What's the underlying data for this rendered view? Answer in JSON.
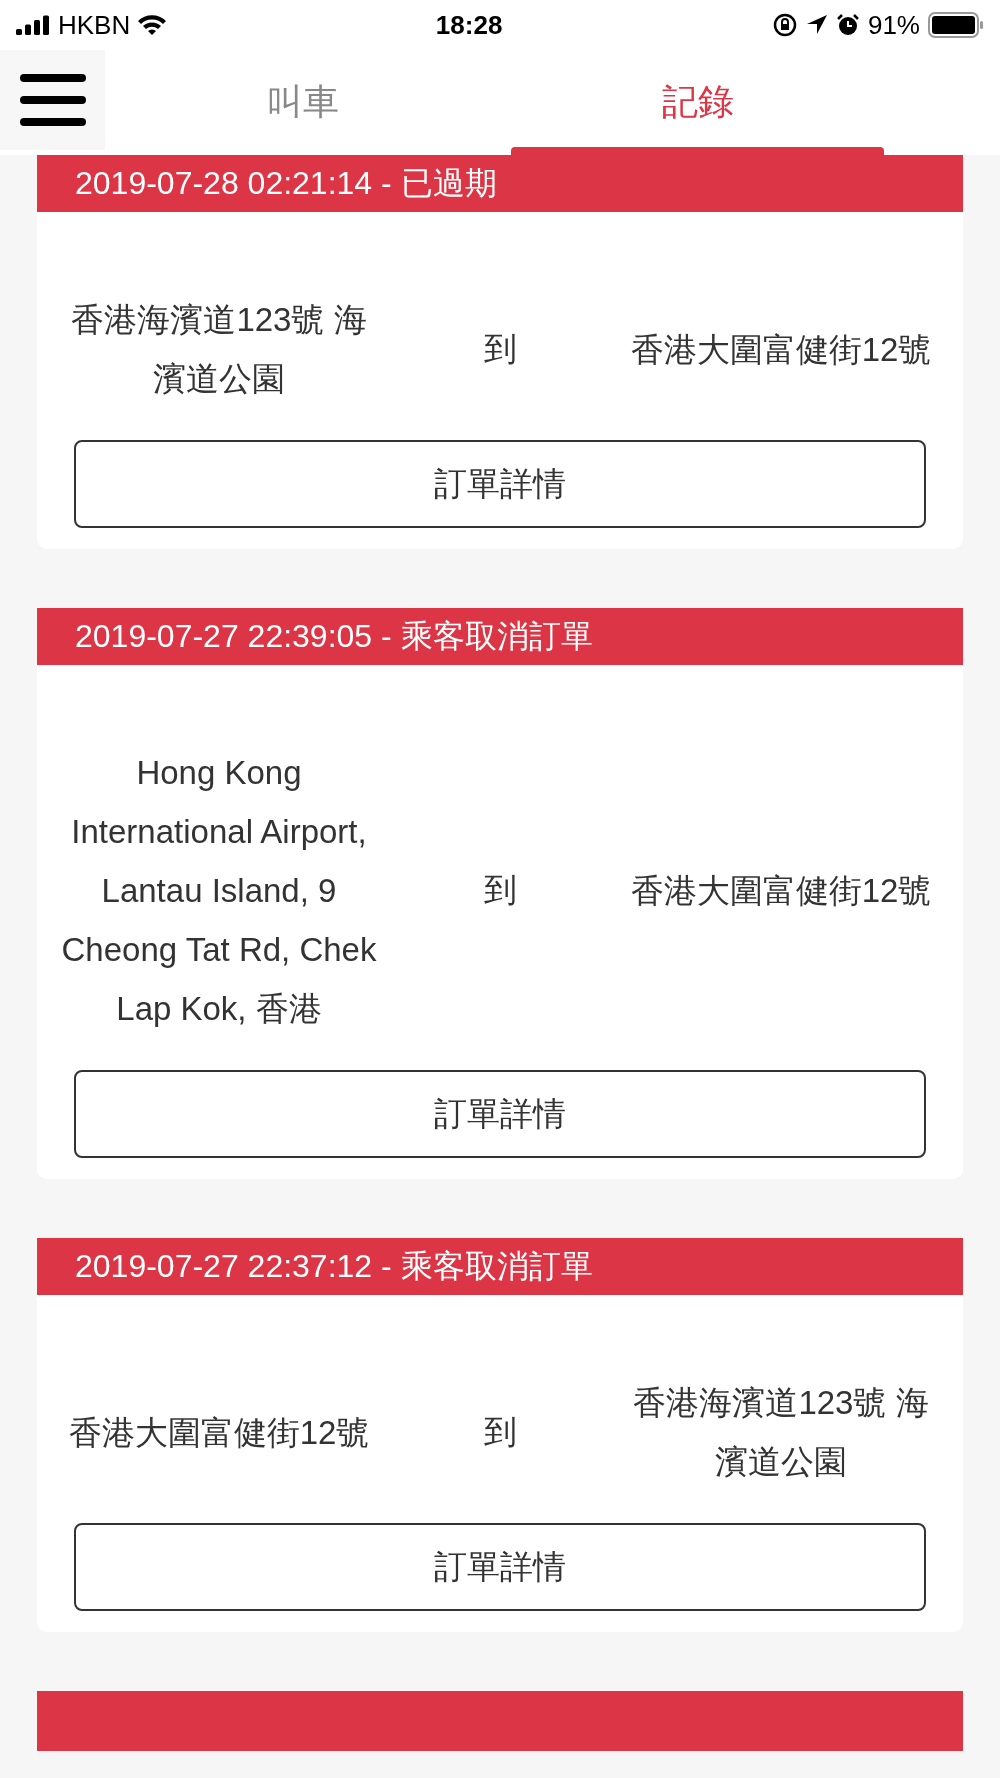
{
  "status_bar": {
    "carrier": "HKBN",
    "time": "18:28",
    "battery": "91%"
  },
  "tabs": [
    {
      "label": "叫車",
      "selected": false
    },
    {
      "label": "記錄",
      "selected": true
    }
  ],
  "orders": [
    {
      "kind": "full",
      "header": "2019-07-28 02:21:14 - 已過期",
      "from": "香港海濱道123號 海濱道公園",
      "connector": "到",
      "to": "香港大圍富健街12號",
      "button": "訂單詳情"
    },
    {
      "kind": "full",
      "header": "2019-07-27 22:39:05 - 乘客取消訂單",
      "from": "Hong Kong International Airport, Lantau Island, 9 Cheong Tat Rd, Chek Lap Kok, 香港",
      "connector": "到",
      "to": "香港大圍富健街12號",
      "button": "訂單詳情"
    },
    {
      "kind": "full",
      "header": "2019-07-27 22:37:12 - 乘客取消訂單",
      "from": "香港大圍富健街12號",
      "connector": "到",
      "to": "香港海濱道123號 海濱道公園",
      "button": "訂單詳情"
    },
    {
      "kind": "cut"
    }
  ]
}
